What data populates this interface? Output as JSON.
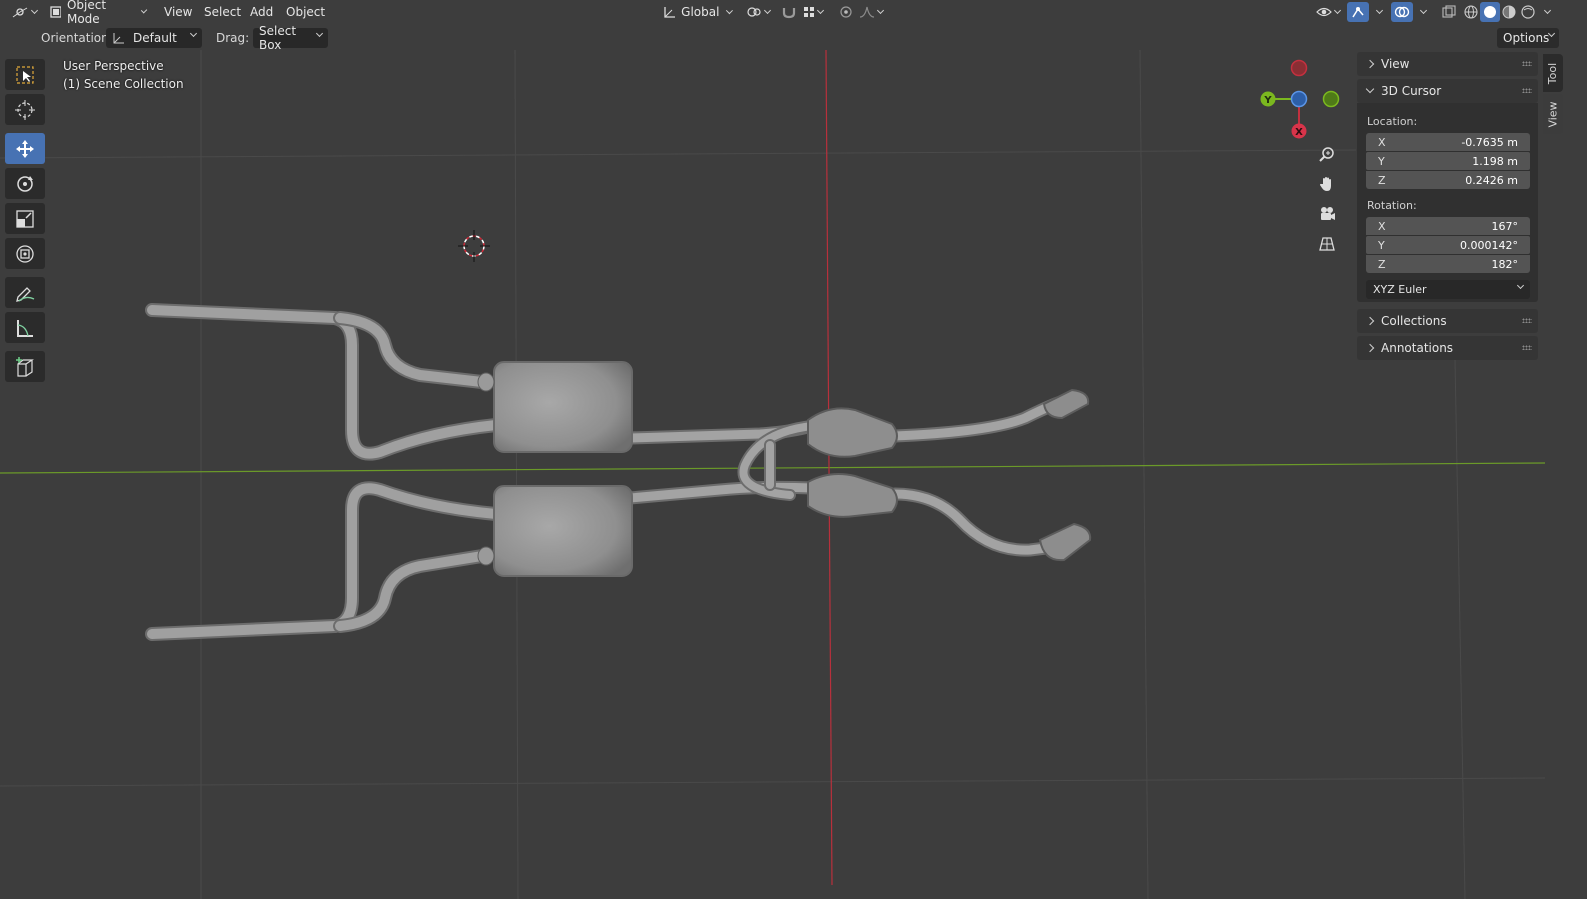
{
  "header": {
    "mode": "Object Mode",
    "menus": [
      "View",
      "Select",
      "Add",
      "Object"
    ],
    "transform_orientation": "Global",
    "options_label": "Options"
  },
  "tool_settings": {
    "orientation_label": "Orientation:",
    "orientation_value": "Default",
    "drag_label": "Drag:",
    "drag_value": "Select Box"
  },
  "toolbar": {
    "tools": [
      "select-box",
      "cursor",
      "move",
      "rotate",
      "scale",
      "transform",
      "annotate",
      "measure",
      "add-cube"
    ],
    "active": "move"
  },
  "overlay": {
    "view_name": "User Perspective",
    "collection": "(1) Scene Collection"
  },
  "gizmo": {
    "axes": [
      "Y",
      "X"
    ]
  },
  "sidebar": {
    "tabs": [
      "Tool",
      "View"
    ],
    "active_tab": "View",
    "sections": {
      "view": "View",
      "cursor": "3D Cursor",
      "collections": "Collections",
      "annotations": "Annotations"
    },
    "location_label": "Location:",
    "location": [
      {
        "axis": "X",
        "value": "-0.7635 m"
      },
      {
        "axis": "Y",
        "value": "1.198 m"
      },
      {
        "axis": "Z",
        "value": "0.2426 m"
      }
    ],
    "rotation_label": "Rotation:",
    "rotation": [
      {
        "axis": "X",
        "value": "167°"
      },
      {
        "axis": "Y",
        "value": "0.000142°"
      },
      {
        "axis": "Z",
        "value": "182°"
      }
    ],
    "rotation_mode": "XYZ Euler"
  },
  "colors": {
    "viewport_bg": "#3d3d3d",
    "active_tool": "#4772b3",
    "x_axis": "#c3303f",
    "y_axis": "#7bb81f",
    "z_axis": "#3f7ad1"
  }
}
